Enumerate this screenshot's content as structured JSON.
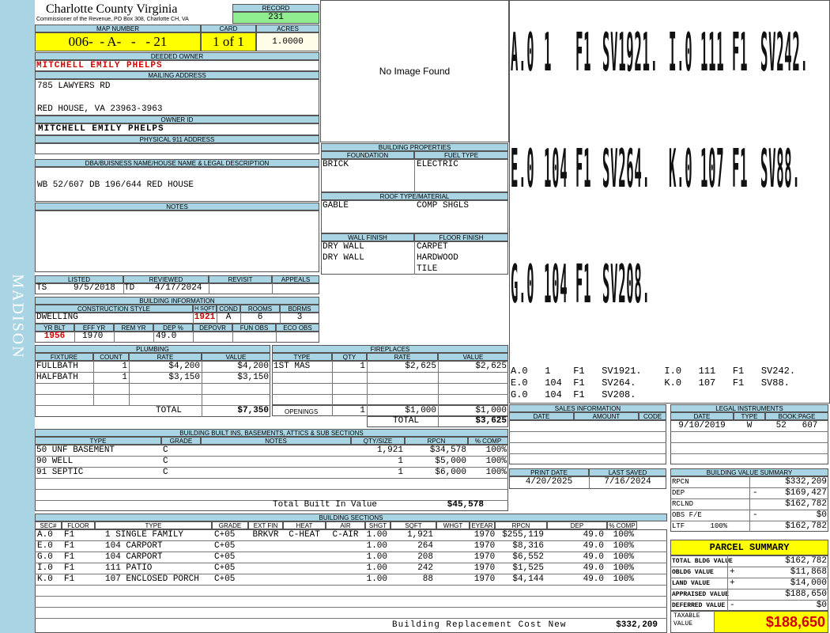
{
  "side_label": "MADISON",
  "county": {
    "name": "Charlotte County Virginia",
    "sub": "Commissioner of the Revenue, PO Box 308, Charlotte CH, VA"
  },
  "record": {
    "label": "RECORD",
    "value": "231"
  },
  "map": {
    "label": "MAP NUMBER",
    "value": "006-  - A-   -   - 21"
  },
  "card": {
    "label": "CARD",
    "value": "1 of 1"
  },
  "acres": {
    "label": "ACRES",
    "value": "1.0000"
  },
  "owner": {
    "label": "DEEDED OWNER",
    "value": "MITCHELL EMILY PHELPS"
  },
  "mailing": {
    "label": "MAILING ADDRESS",
    "line1": "785 LAWYERS RD",
    "line2": "RED HOUSE, VA 23963-3963"
  },
  "owner_id": {
    "label": "OWNER ID",
    "value": "MITCHELL EMILY PHELPS"
  },
  "phys_addr": {
    "label": "PHYSICAL 911 ADDRESS",
    "value": ""
  },
  "dba": {
    "label": "DBA/BUISNESS NAME/HOUSE NAME & LEGAL DESCRIPTION",
    "value": "WB 52/607 DB 196/644 RED HOUSE"
  },
  "notes": {
    "label": "NOTES"
  },
  "image_placeholder": "No Image Found",
  "building_props": {
    "label": "BUILDING PROPERTIES",
    "foundation_label": "FOUNDATION",
    "fuel_label": "FUEL TYPE",
    "foundation": "BRICK",
    "fuel": "ELECTRIC",
    "roof_label": "ROOF TYPE/MATERIAL",
    "roof_type": "GABLE",
    "roof_material": "COMP SHGLS",
    "wall_label": "WALL FINISH",
    "floor_label": "FLOOR FINISH",
    "walls": [
      "DRY WALL",
      "DRY WALL"
    ],
    "floors": [
      "CARPET",
      "HARDWOOD",
      "TILE"
    ]
  },
  "sketch": {
    "big": [
      [
        "A.0",
        "1",
        "F1",
        "SV1921.",
        "I.0",
        "111",
        "F1",
        "SV242."
      ],
      [
        "E.0",
        "104",
        "F1",
        "SV264.",
        "K.0",
        "107",
        "F1",
        "SV88."
      ],
      [
        "G.0",
        "104",
        "F1",
        "SV208."
      ]
    ],
    "small": [
      "A.0   1    F1   SV1921.    I.0   111   F1   SV242.",
      "E.0   104  F1   SV264.     K.0   107   F1   SV88.",
      "G.0   104  F1   SV208."
    ]
  },
  "listed": {
    "listed_label": "LISTED",
    "reviewed_label": "REVIEWED",
    "revisit_label": "REVISIT",
    "appeals_label": "APPEALS",
    "listed_by": "TS",
    "listed_date": "9/5/2018",
    "reviewed_by": "TD",
    "reviewed_date": "4/17/2024"
  },
  "building_info": {
    "label": "BUILDING INFORMATION",
    "style_label": "CONSTRUCTION STYLE",
    "hsqft_label": "H SQFT",
    "cond_label": "COND",
    "rooms_label": "ROOMS",
    "bdrms_label": "BDRMS",
    "style": "DWELLING",
    "hsqft": "1921",
    "cond": "A",
    "rooms": "6",
    "bdrms": "3",
    "yrblt_label": "YR BLT",
    "effyr_label": "EFF YR",
    "remyr_label": "REM YR",
    "dep_label": "DEP %",
    "depovr_label": "DEPOVR",
    "funobs_label": "FUN OBS",
    "ecoobs_label": "ECO OBS",
    "yrblt": "1956",
    "effyr": "1970",
    "dep": "49.0"
  },
  "plumbing": {
    "label": "PLUMBING",
    "headers": [
      "FIXTURE",
      "COUNT",
      "RATE",
      "VALUE"
    ],
    "rows": [
      [
        "FULLBATH",
        "1",
        "$4,200",
        "$4,200"
      ],
      [
        "HALFBATH",
        "1",
        "$3,150",
        "$3,150"
      ]
    ],
    "total_label": "TOTAL",
    "total": "$7,350"
  },
  "fireplaces": {
    "label": "FIREPLACES",
    "headers": [
      "TYPE",
      "QTY",
      "RATE",
      "VALUE"
    ],
    "rows": [
      [
        "1ST MAS",
        "1",
        "$2,625",
        "$2,625"
      ]
    ],
    "openings_label": "OPENINGS",
    "openings": [
      "1",
      "$1,000",
      "$1,000"
    ],
    "total_label": "TOTAL",
    "total": "$3,625"
  },
  "sales": {
    "label": "SALES INFORMATION",
    "headers": [
      "DATE",
      "AMOUNT",
      "CODE"
    ]
  },
  "legal": {
    "label": "LEGAL INSTRUMENTS",
    "headers": [
      "DATE",
      "TYPE",
      "BOOK:PAGE"
    ],
    "row": [
      "9/10/2019",
      "W",
      "52   607"
    ]
  },
  "builtins": {
    "label": "BUILDING BUILT INS, BASEMENTS, ATTICS & SUB SECTIONS",
    "headers": [
      "TYPE",
      "GRADE",
      "NOTES",
      "QTY/SIZE",
      "RPCN",
      "% COMP"
    ],
    "rows": [
      [
        "50 UNF BASEMENT",
        "C",
        "",
        "1,921",
        "$34,578",
        "100%"
      ],
      [
        "90 WELL",
        "C",
        "",
        "1",
        "$5,000",
        "100%"
      ],
      [
        "91 SEPTIC",
        "C",
        "",
        "1",
        "$6,000",
        "100%"
      ]
    ],
    "total_label": "Total Built In Value",
    "total": "$45,578"
  },
  "print": {
    "print_label": "PRINT DATE",
    "saved_label": "LAST SAVED",
    "print_date": "4/20/2025",
    "saved_date": "7/16/2024"
  },
  "bvs": {
    "label": "BUILDING VALUE SUMMARY",
    "rows": [
      [
        "RPCN",
        "",
        "$332,209"
      ],
      [
        "DEP",
        "-",
        "$169,427"
      ],
      [
        "RCLND",
        "",
        "$162,782"
      ],
      [
        "OBS F/E",
        "-",
        "$0"
      ],
      [
        "LTF      100%",
        "",
        "$162,782"
      ]
    ]
  },
  "sections": {
    "label": "BUILDING SECTIONS",
    "headers": [
      "SEC#",
      "FLOOR",
      "TYPE",
      "GRADE",
      "EXT FIN",
      "HEAT",
      "AIR",
      "SHGT",
      "SQFT",
      "WHGT",
      "EYEAR",
      "RPCN",
      "DEP",
      "% COMP"
    ],
    "rows": [
      [
        "A.0",
        "F1",
        "1 SINGLE FAMILY",
        "C+05",
        "BRKVR",
        "C-HEAT",
        "C-AIR",
        "1.00",
        "1,921",
        "",
        "1970",
        "$255,119",
        "49.0",
        "100%"
      ],
      [
        "E.0",
        "F1",
        "104 CARPORT",
        "C+05",
        "",
        "",
        "",
        "1.00",
        "264",
        "",
        "1970",
        "$8,316",
        "49.0",
        "100%"
      ],
      [
        "G.0",
        "F1",
        "104 CARPORT",
        "C+05",
        "",
        "",
        "",
        "1.00",
        "208",
        "",
        "1970",
        "$6,552",
        "49.0",
        "100%"
      ],
      [
        "I.0",
        "F1",
        "111 PATIO",
        "C+05",
        "",
        "",
        "",
        "1.00",
        "242",
        "",
        "1970",
        "$1,525",
        "49.0",
        "100%"
      ],
      [
        "K.0",
        "F1",
        "107 ENCLOSED PORCH",
        "C+05",
        "",
        "",
        "",
        "1.00",
        "88",
        "",
        "1970",
        "$4,144",
        "49.0",
        "100%"
      ]
    ],
    "brcn_label": "Building Replacement Cost New",
    "brcn": "$332,209"
  },
  "parcel": {
    "label": "PARCEL SUMMARY",
    "rows": [
      [
        "TOTAL BLDG VALUE",
        "",
        "$162,782"
      ],
      [
        "OBLDG VALUE",
        "+",
        "$11,868"
      ],
      [
        "LAND VALUE",
        "+",
        "$14,000"
      ],
      [
        "APPRAISED VALUE",
        "",
        "$188,650"
      ],
      [
        "DEFERRED VALUE",
        "-",
        "$0"
      ]
    ],
    "taxable_label": "TAXABLE VALUE",
    "taxable": "$188,650"
  }
}
